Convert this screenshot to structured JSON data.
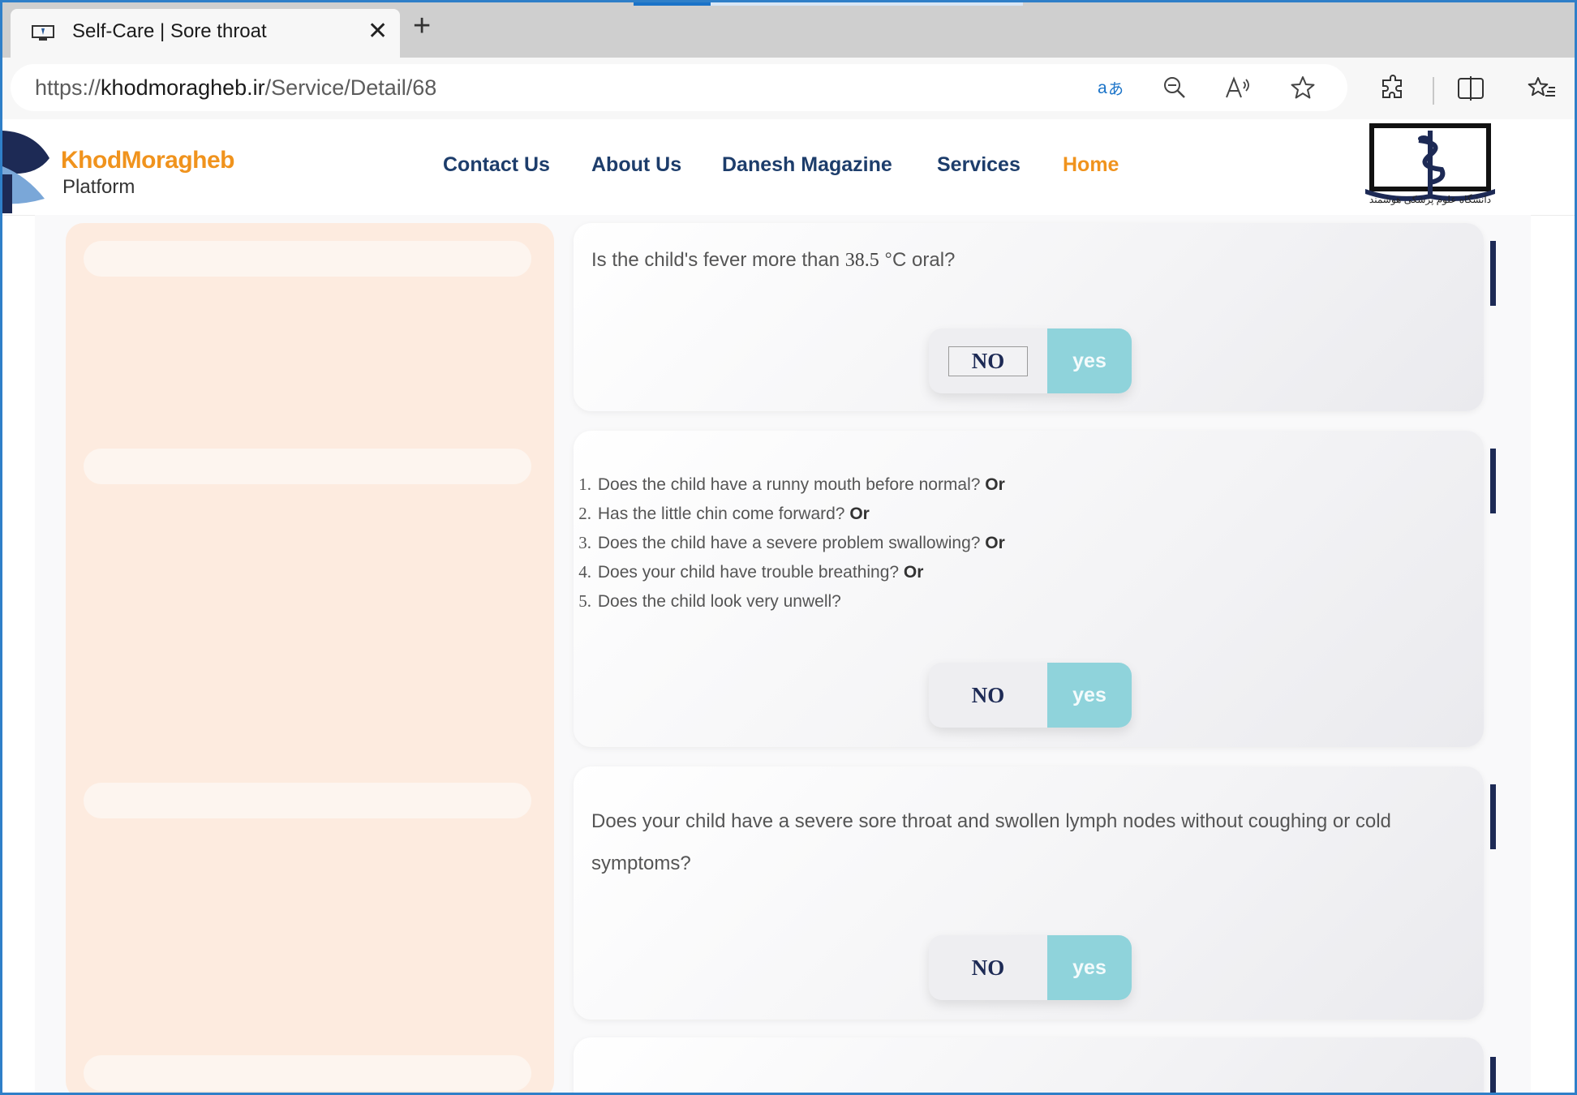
{
  "browser": {
    "tab_title": "Self-Care | Sore throat",
    "url_scheme": "https://",
    "url_host": "khodmoragheb.ir",
    "url_path": "/Service/Detail/68",
    "icons": [
      "translate-icon",
      "zoom-out-icon",
      "read-aloud-icon",
      "favorite-star-icon",
      "extensions-icon",
      "split-screen-icon",
      "favorites-icon"
    ]
  },
  "site": {
    "logo_title": "KhodMoragheb",
    "logo_subtitle": "Platform",
    "nav": [
      "Contact Us",
      "About Us",
      "Danesh Magazine",
      "Services",
      "Home"
    ],
    "active_nav": "Home",
    "university_caption": "دانشگاه علوم پزشکی هوشمند"
  },
  "questions": [
    {
      "text_before": "Is the child's fever more than ",
      "temp": "38.5",
      "text_after": " °C oral?",
      "no_label": "NO",
      "yes_label": "yes"
    },
    {
      "items": [
        {
          "num": "1.",
          "text": "Does the child have a runny mouth before normal?",
          "or": "Or"
        },
        {
          "num": "2.",
          "text": "Has the little chin come forward?",
          "or": "Or"
        },
        {
          "num": "3.",
          "text": "Does the child have a severe problem swallowing?",
          "or": "Or"
        },
        {
          "num": "4.",
          "text": "Does your child have trouble breathing?",
          "or": "Or"
        },
        {
          "num": "5.",
          "text": "Does the child look very unwell?",
          "or": ""
        }
      ],
      "no_label": "NO",
      "yes_label": "yes"
    },
    {
      "text": "Does your child have a severe sore throat and swollen lymph nodes without coughing or cold symptoms?",
      "no_label": "NO",
      "yes_label": "yes"
    }
  ],
  "colors": {
    "accent_orange": "#f0931d",
    "nav_blue": "#1d3d6b",
    "yes_teal": "#8fd3db",
    "sidebar_peach": "#fdebdf"
  }
}
